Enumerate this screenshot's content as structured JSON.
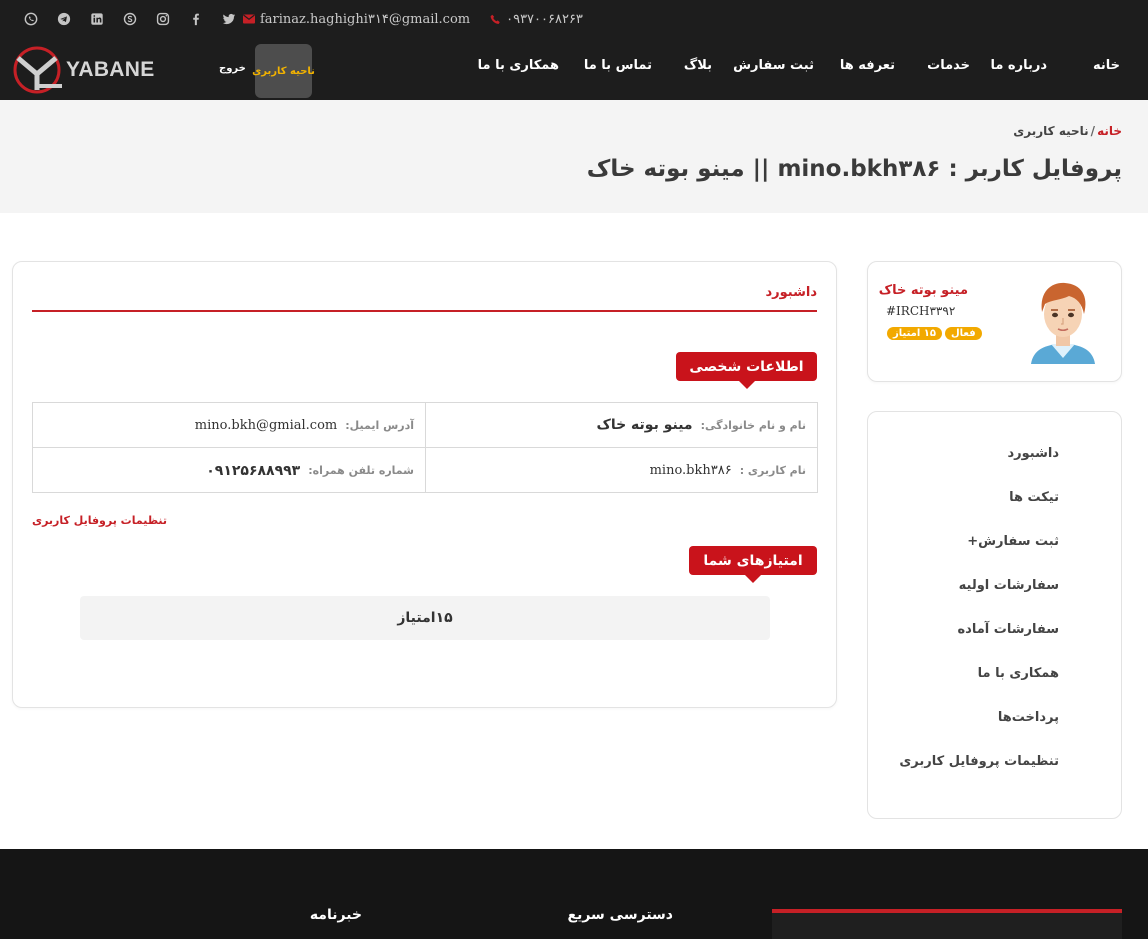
{
  "topbar": {
    "social": [
      {
        "icon": "whatsapp-icon"
      },
      {
        "icon": "telegram-icon"
      },
      {
        "icon": "linkedin-icon"
      },
      {
        "icon": "skype-icon"
      },
      {
        "icon": "instagram-icon"
      },
      {
        "icon": "facebook-icon"
      },
      {
        "icon": "twitter-icon"
      }
    ],
    "email": "farinaz.haghighi۳۱۴@gmail.com",
    "phone": "۰۹۳۷۰۰۶۸۲۶۳",
    "accent_color": "#c62026"
  },
  "header": {
    "logo_text": "YABANE",
    "exit_label": "خروج",
    "user_area_label": "ناحیه کاربری",
    "nav": [
      "خانه",
      "درباره ما",
      "خدمات",
      "تعرفه ها",
      "ثبت سفارش",
      "بلاگ",
      "تماس با ما",
      "همکاری با ما"
    ]
  },
  "breadcrumb": {
    "home": "خانه",
    "separator": "/",
    "current": "ناحیه کاربری"
  },
  "page_title": "پروفایل کاربر : mino.bkh۳۸۶ || مینو بوته خاک",
  "profile": {
    "name": "مینو بوته خاک",
    "code": "#IRCH۳۳۹۲",
    "status": "فعال",
    "points_badge": "۱۵ امتیاز"
  },
  "sidebar": {
    "items": [
      {
        "label": "داشبورد"
      },
      {
        "label": "تیکت ها"
      },
      {
        "label": "ثبت سفارش+"
      },
      {
        "label": "سفارشات اولیه"
      },
      {
        "label": "سفارشات آماده"
      },
      {
        "label": "همکاری با ما"
      },
      {
        "label": "پرداخت‌ها"
      },
      {
        "label": "تنظیمات پروفایل کاربری"
      }
    ]
  },
  "dashboard": {
    "title": "داشبورد",
    "personal_info_heading": "اطلاعات شخصی",
    "fields": {
      "fullname_label": "نام و نام خانوادگی:",
      "fullname_value": "مینو بوته خاک",
      "email_label": "آدرس ایمیل:",
      "email_value": "mino.bkh@gmial.com",
      "username_label": "نام کاربری :",
      "username_value": "mino.bkh۳۸۶",
      "phone_label": "شماره تلفن همراه:",
      "phone_value": "۰۹۱۲۵۶۸۸۹۹۳"
    },
    "settings_link": "تنظیمات پروفایل کاربری",
    "points_heading": "امتیازهای شما",
    "points_value": "۱۵امتیاز"
  },
  "footer": {
    "quick_access": "دسترسی سریع",
    "newsletter": "خبرنامه"
  }
}
